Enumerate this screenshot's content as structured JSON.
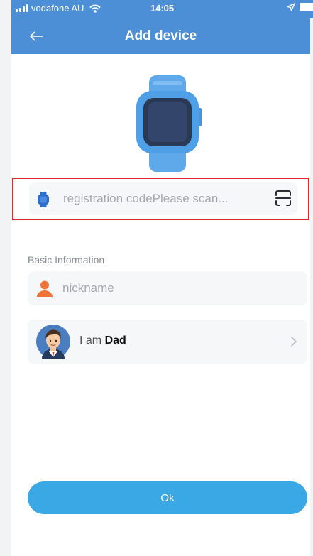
{
  "status_bar": {
    "carrier": "vodafone AU",
    "time": "14:05",
    "icons": [
      "signal-icon",
      "wifi-icon",
      "location-arrow-icon",
      "battery-icon"
    ]
  },
  "nav": {
    "title": "Add device",
    "back_icon": "back-arrow-icon"
  },
  "registration": {
    "value": "",
    "placeholder": "registration codePlease scan...",
    "icon": "watch-icon",
    "scan_icon": "scan-qr-icon"
  },
  "basic_info": {
    "section_title": "Basic Information",
    "nickname": {
      "value": "",
      "placeholder": "nickname",
      "icon": "person-icon"
    },
    "relation": {
      "prefix": "I am ",
      "role": "Dad",
      "avatar": "dad-avatar",
      "chevron": "chevron-right-icon"
    }
  },
  "ok_button": {
    "label": "Ok"
  },
  "colors": {
    "header": "#4d8fd6",
    "button": "#3aa8e4",
    "field_bg": "#f6f7f8",
    "highlight_border": "#e0262c",
    "person_icon": "#f0743a"
  }
}
